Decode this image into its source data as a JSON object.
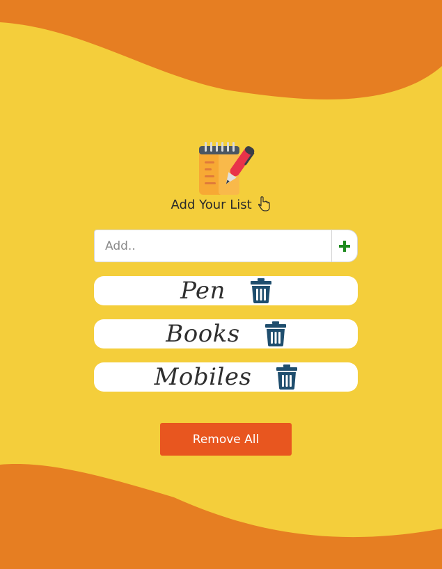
{
  "colors": {
    "background": "#f4ce3b",
    "wave": "#e67e22",
    "accent_button": "#e8561f",
    "trash_icon": "#1f4e6e",
    "plus_icon": "#1e8a1e"
  },
  "header": {
    "logo_icon": "notepad-pen-icon",
    "title": "Add Your List",
    "pointer_icon": "hand-pointing-down-icon"
  },
  "add_form": {
    "placeholder": "Add..",
    "value": "",
    "add_icon": "plus-icon"
  },
  "items": [
    {
      "label": "Pen",
      "delete_icon": "trash-icon"
    },
    {
      "label": "Books",
      "delete_icon": "trash-icon"
    },
    {
      "label": "Mobiles",
      "delete_icon": "trash-icon"
    }
  ],
  "actions": {
    "remove_all_label": "Remove All"
  }
}
